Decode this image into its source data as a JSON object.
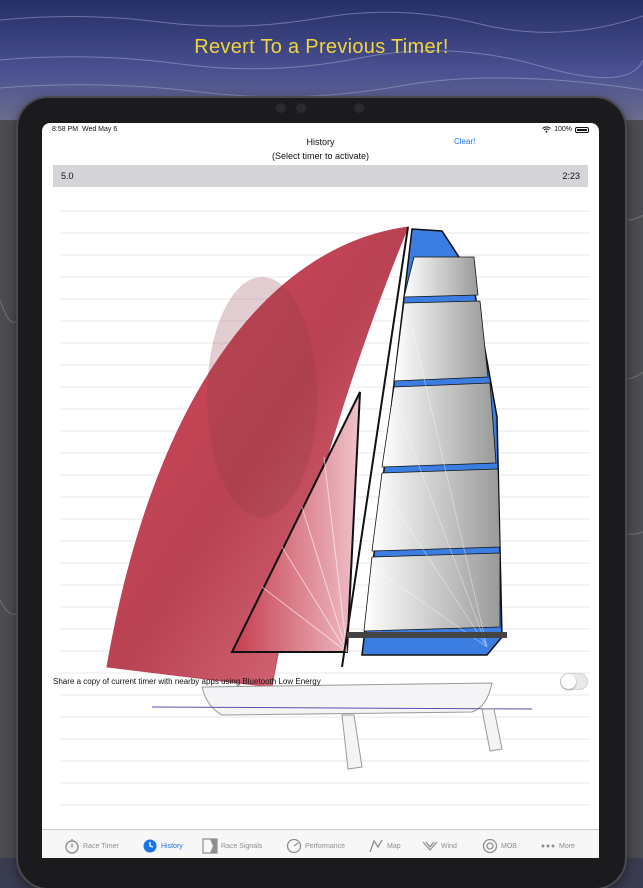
{
  "headline": "Revert To a Previous Timer!",
  "status": {
    "time": "8:58 PM",
    "date": "Wed May 6",
    "battery": "100%"
  },
  "nav": {
    "title": "History",
    "subtitle": "(Select timer to activate)",
    "clear_label": "Clear!"
  },
  "history": [
    {
      "left": "5.0",
      "right": "2:23"
    }
  ],
  "share": {
    "label": "Share a copy of current timer with nearby apps using Bluetooth Low Energy",
    "enabled": false
  },
  "tabs": [
    {
      "label": "Race Timer",
      "icon": "stopwatch-icon",
      "active": false
    },
    {
      "label": "History",
      "icon": "clock-icon",
      "active": true
    },
    {
      "label": "Race Signals",
      "icon": "flag-icon",
      "active": false
    },
    {
      "label": "Performance",
      "icon": "gauge-icon",
      "active": false
    },
    {
      "label": "Map",
      "icon": "map-icon",
      "active": false
    },
    {
      "label": "Wind",
      "icon": "wind-icon",
      "active": false
    },
    {
      "label": "MOB",
      "icon": "lifebuoy-icon",
      "active": false
    },
    {
      "label": "More",
      "icon": "more-icon",
      "active": false
    }
  ],
  "colors": {
    "accent": "#1a73e8",
    "headline": "#f2d43c",
    "spinnaker": "#d9485a",
    "mast": "#3b7de0"
  }
}
